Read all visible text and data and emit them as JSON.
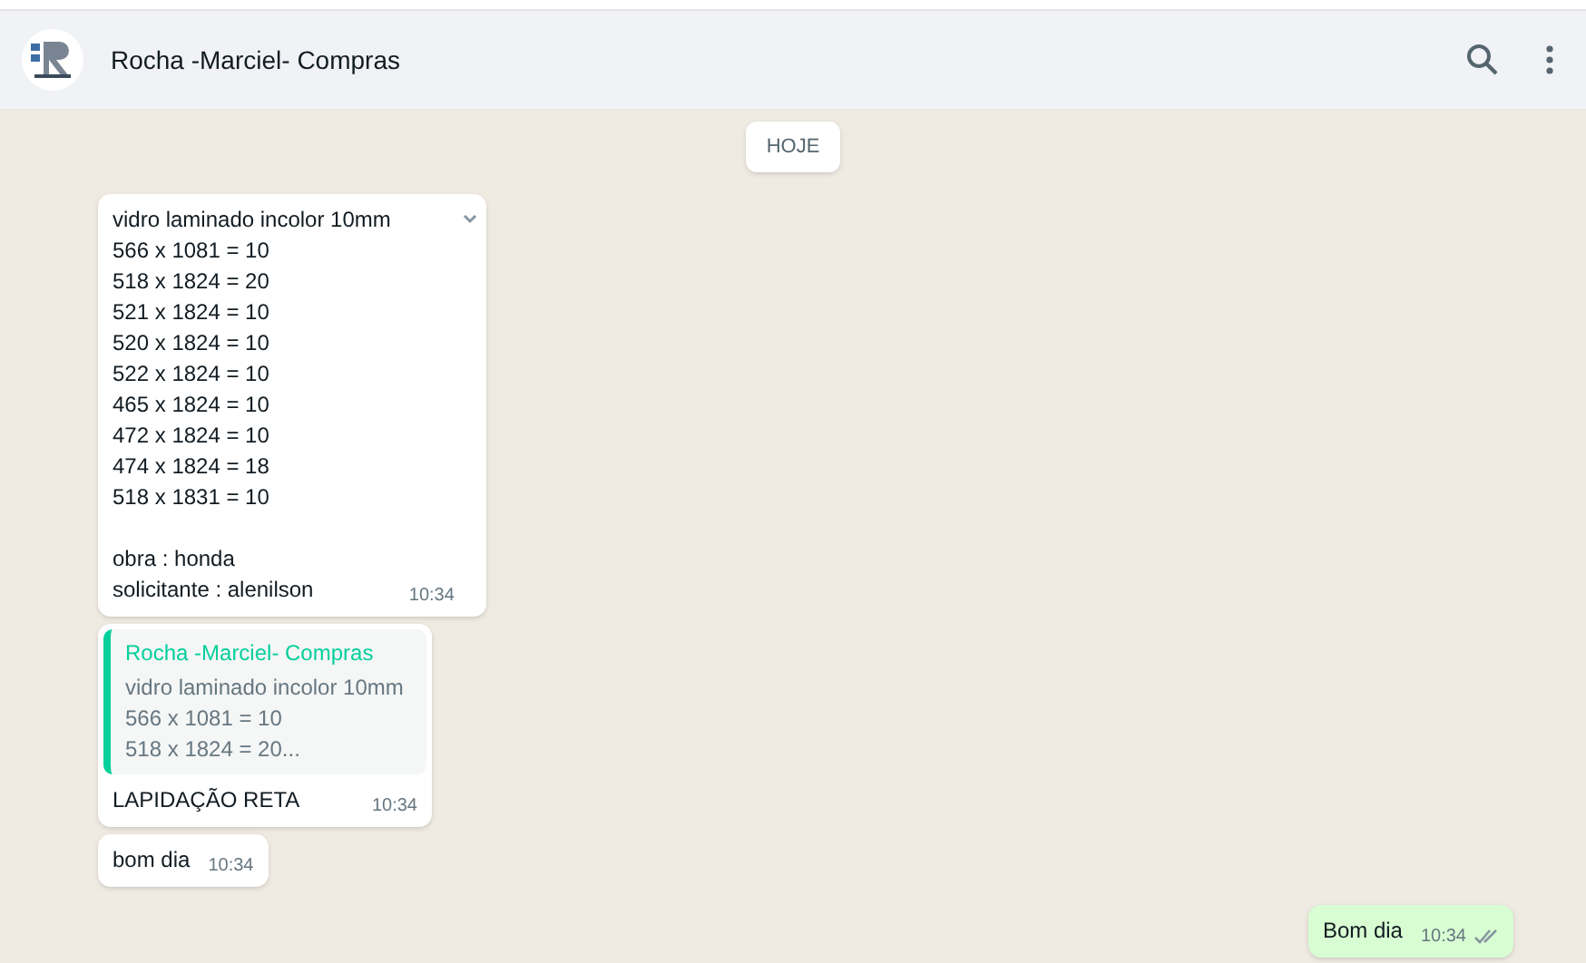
{
  "header": {
    "title": "Rocha -Marciel- Compras"
  },
  "date_chip": "HOJE",
  "messages": [
    {
      "kind": "text",
      "outgoing": false,
      "lines": [
        "vidro laminado incolor 10mm",
        "566 x 1081 = 10",
        "518 x 1824 = 20",
        "521 x 1824 = 10",
        "520 x 1824 = 10",
        "522 x 1824 = 10",
        "465 x 1824 = 10",
        "472 x 1824 = 10",
        "474 x 1824 = 18",
        "518 x 1831 = 10"
      ],
      "extra_lines": [
        "obra : honda",
        "solicitante : alenilson"
      ],
      "time": "10:34"
    },
    {
      "kind": "reply",
      "outgoing": false,
      "quote": {
        "author": "Rocha -Marciel- Compras",
        "lines": [
          "vidro laminado incolor 10mm",
          "566 x 1081 = 10",
          "518 x 1824 = 20..."
        ]
      },
      "lines": [
        "LAPIDAÇÃO RETA"
      ],
      "time": "10:34"
    },
    {
      "kind": "text",
      "outgoing": false,
      "lines": [
        "bom dia"
      ],
      "time": "10:34"
    },
    {
      "kind": "text",
      "outgoing": true,
      "lines": [
        "Bom dia"
      ],
      "time": "10:34",
      "read": false
    }
  ]
}
